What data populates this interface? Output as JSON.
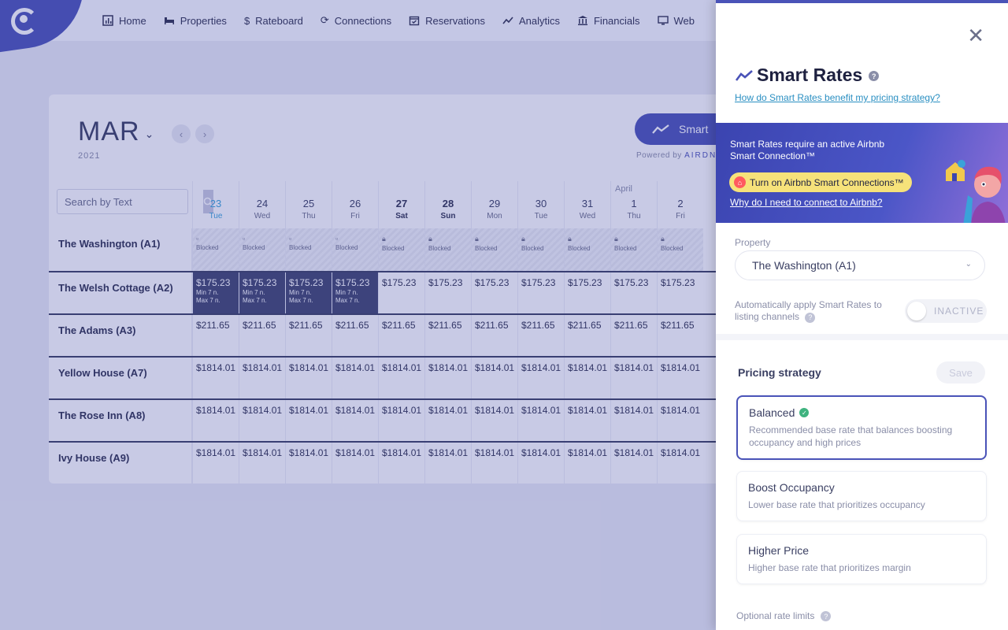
{
  "nav": {
    "items": [
      {
        "label": "Home",
        "icon": "bar-chart-icon"
      },
      {
        "label": "Properties",
        "icon": "bed-icon"
      },
      {
        "label": "Rateboard",
        "icon": "dollar-icon"
      },
      {
        "label": "Connections",
        "icon": "sync-icon"
      },
      {
        "label": "Reservations",
        "icon": "calendar-check-icon"
      },
      {
        "label": "Analytics",
        "icon": "trend-icon"
      },
      {
        "label": "Financials",
        "icon": "bank-icon"
      },
      {
        "label": "Web",
        "icon": "monitor-icon"
      }
    ]
  },
  "calendar": {
    "month": "MAR",
    "year": "2021",
    "smart_button": "Smart",
    "powered_by": "Powered by",
    "powered_brand": "AIRDNA",
    "search_placeholder": "Search by Text",
    "next_month_label": "April",
    "days": [
      {
        "num": "23",
        "wd": "Tue",
        "state": "today"
      },
      {
        "num": "24",
        "wd": "Wed",
        "state": ""
      },
      {
        "num": "25",
        "wd": "Thu",
        "state": ""
      },
      {
        "num": "26",
        "wd": "Fri",
        "state": ""
      },
      {
        "num": "27",
        "wd": "Sat",
        "state": "weekend"
      },
      {
        "num": "28",
        "wd": "Sun",
        "state": "weekend"
      },
      {
        "num": "29",
        "wd": "Mon",
        "state": ""
      },
      {
        "num": "30",
        "wd": "Tue",
        "state": ""
      },
      {
        "num": "31",
        "wd": "Wed",
        "state": ""
      },
      {
        "num": "1",
        "wd": "Thu",
        "state": ""
      },
      {
        "num": "2",
        "wd": "Fri",
        "state": ""
      }
    ],
    "properties": [
      {
        "name": "The Washington (A1)",
        "kind": "blocked",
        "blocked_label": "Blocked"
      },
      {
        "name": "The Welsh Cottage (A2)",
        "kind": "rate",
        "rate": "$175.23",
        "dark_count": 4,
        "min": "Min 7 n.",
        "max": "Max 7 n."
      },
      {
        "name": "The Adams (A3)",
        "kind": "rate",
        "rate": "$211.65",
        "dark_count": 0
      },
      {
        "name": "Yellow House (A7)",
        "kind": "rate",
        "rate": "$1814.01",
        "dark_count": 0
      },
      {
        "name": "The Rose Inn (A8)",
        "kind": "rate",
        "rate": "$1814.01",
        "dark_count": 0
      },
      {
        "name": "Ivy House (A9)",
        "kind": "rate",
        "rate": "$1814.01",
        "dark_count": 0
      }
    ]
  },
  "panel": {
    "title": "Smart Rates",
    "help_link": "How do Smart Rates benefit my pricing strategy?",
    "banner_text": "Smart Rates require an active Airbnb Smart Connection™",
    "banner_button": "Turn on Airbnb Smart Connections™",
    "banner_link": "Why do I need to connect to Airbnb?",
    "property_label": "Property",
    "property_value": "The Washington (A1)",
    "auto_apply": "Automatically apply Smart Rates to listing channels",
    "toggle_label": "INACTIVE",
    "strategy_label": "Pricing strategy",
    "save_label": "Save",
    "options": [
      {
        "title": "Balanced",
        "desc": "Recommended base rate that balances boosting occupancy and high prices",
        "selected": true
      },
      {
        "title": "Boost Occupancy",
        "desc": "Lower base rate that prioritizes occupancy",
        "selected": false
      },
      {
        "title": "Higher Price",
        "desc": "Higher base rate that prioritizes margin",
        "selected": false
      }
    ],
    "limits_label": "Optional rate limits"
  },
  "colors": {
    "accent": "#4a53b8",
    "today": "#3aa2d9",
    "ok": "#3fb37f"
  }
}
